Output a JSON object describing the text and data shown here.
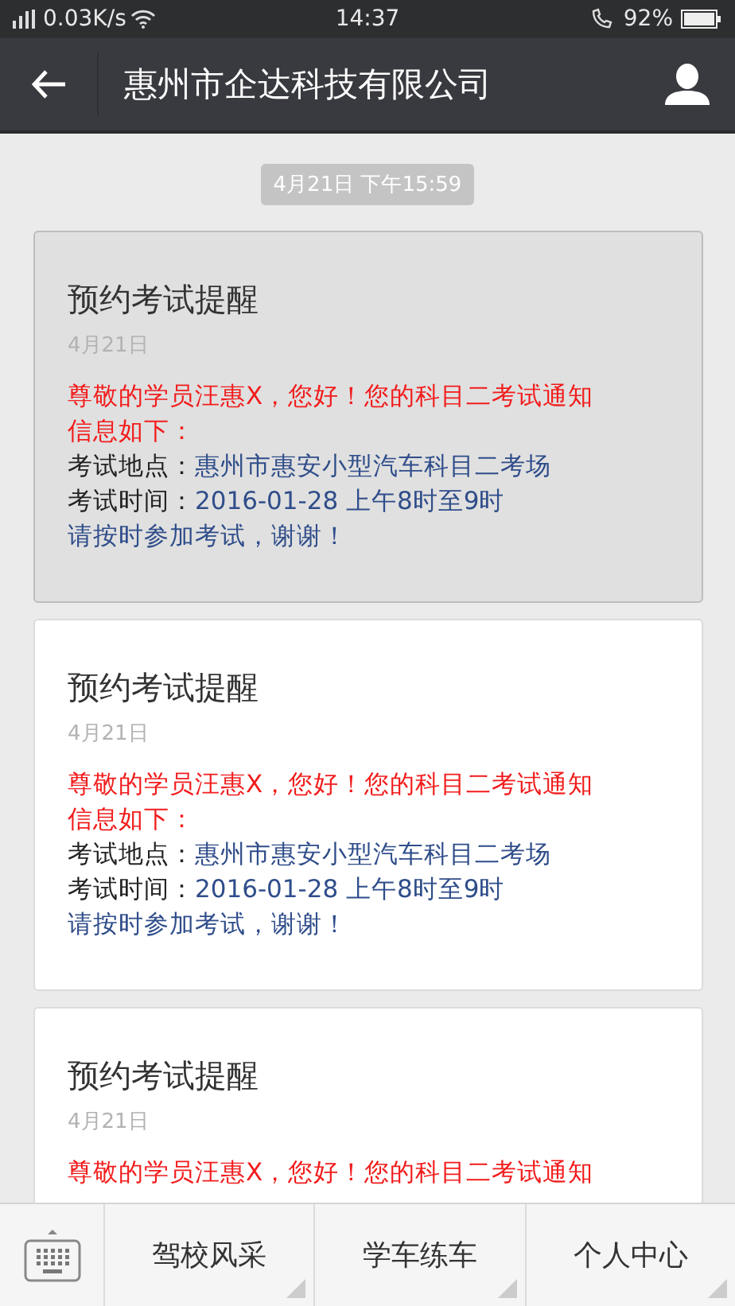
{
  "status_bar": {
    "speed": "0.03K/s",
    "time": "14:37",
    "battery": "92%"
  },
  "header": {
    "title": "惠州市企达科技有限公司"
  },
  "timestamp": "4月21日 下午15:59",
  "cards": [
    {
      "title": "预约考试提醒",
      "date": "4月21日",
      "pressed": true,
      "lines": [
        {
          "kind": "alert",
          "text": "尊敬的学员汪惠X，您好！您的科目二考试通知"
        },
        {
          "kind": "alert",
          "text": "信息如下："
        },
        {
          "kind": "field",
          "label": "考试地点：",
          "text": "惠州市惠安小型汽车科目二考场"
        },
        {
          "kind": "field",
          "label": "考试时间：",
          "text": "2016-01-28 上午8时至9时"
        },
        {
          "kind": "note",
          "text": "请按时参加考试，谢谢！"
        }
      ]
    },
    {
      "title": "预约考试提醒",
      "date": "4月21日",
      "pressed": false,
      "lines": [
        {
          "kind": "alert",
          "text": "尊敬的学员汪惠X，您好！您的科目二考试通知"
        },
        {
          "kind": "alert",
          "text": "信息如下："
        },
        {
          "kind": "field",
          "label": "考试地点：",
          "text": "惠州市惠安小型汽车科目二考场"
        },
        {
          "kind": "field",
          "label": "考试时间：",
          "text": "2016-01-28 上午8时至9时"
        },
        {
          "kind": "note",
          "text": "请按时参加考试，谢谢！"
        }
      ]
    },
    {
      "title": "预约考试提醒",
      "date": "4月21日",
      "pressed": false,
      "lines": [
        {
          "kind": "alert",
          "text": "尊敬的学员汪惠X，您好！您的科目二考试通知"
        }
      ]
    }
  ],
  "menu": [
    "驾校风采",
    "学车练车",
    "个人中心"
  ]
}
